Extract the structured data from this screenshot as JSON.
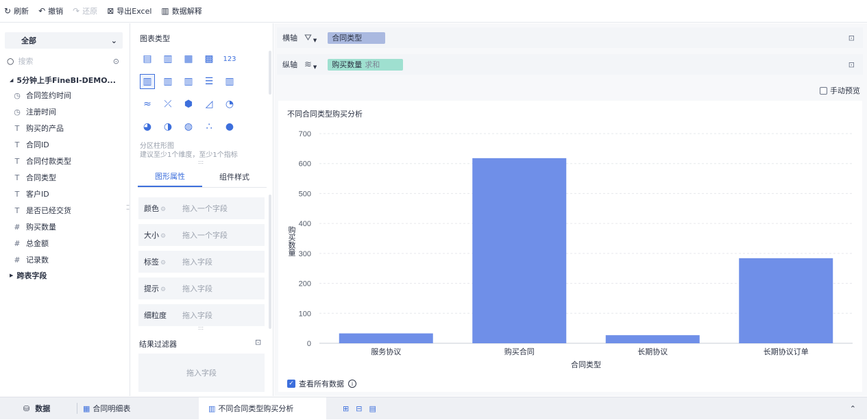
{
  "toolbar": {
    "refresh": "刷新",
    "undo": "撤销",
    "redo": "还原",
    "export": "导出Excel",
    "explain": "数据解释"
  },
  "left": {
    "scope": "全部",
    "search_placeholder": "搜索",
    "root": "5分钟上手FineBI-DEMO...",
    "fields": [
      {
        "icon": "clock-icon",
        "label": "合同签约时间"
      },
      {
        "icon": "clock-icon",
        "label": "注册时间"
      },
      {
        "icon": "text-icon",
        "label": "购买的产品"
      },
      {
        "icon": "text-icon",
        "label": "合同ID"
      },
      {
        "icon": "text-icon",
        "label": "合同付款类型"
      },
      {
        "icon": "text-icon",
        "label": "合同类型"
      },
      {
        "icon": "text-icon",
        "label": "客户ID"
      },
      {
        "icon": "text-icon",
        "label": "是否已经交货"
      },
      {
        "icon": "number-icon",
        "label": "购买数量"
      },
      {
        "icon": "number-icon",
        "label": "总金额"
      },
      {
        "icon": "number-icon",
        "label": "记录数"
      }
    ],
    "cross_table": "跨表字段"
  },
  "middle": {
    "chart_type_title": "图表类型",
    "chart_hint_title": "分区柱形图",
    "chart_hint_desc": "建议至少1个维度，至少1个指标",
    "tab_graph": "图形属性",
    "tab_component": "组件样式",
    "props": [
      {
        "label": "颜色",
        "value": "拖入一个字段",
        "gear": true
      },
      {
        "label": "大小",
        "value": "拖入一个字段",
        "gear": true
      },
      {
        "label": "标签",
        "value": "拖入字段",
        "gear": true
      },
      {
        "label": "提示",
        "value": "拖入字段",
        "gear": true
      },
      {
        "label": "细粒度",
        "value": "拖入字段",
        "gear": false
      }
    ],
    "filter_title": "结果过滤器",
    "filter_placeholder": "拖入字段"
  },
  "right": {
    "x_axis_label": "横轴",
    "x_field": "合同类型",
    "y_axis_label": "纵轴",
    "y_field": "购买数量",
    "y_agg": "求和",
    "manual_preview": "手动预览",
    "view_all": "查看所有数据"
  },
  "chart_data": {
    "type": "bar",
    "title": "不同合同类型购买分析",
    "xlabel": "合同类型",
    "ylabel": "购买数量",
    "categories": [
      "服务协议",
      "购买合同",
      "长期协议",
      "长期协议订单"
    ],
    "values": [
      33,
      618,
      27,
      284
    ],
    "ylim": [
      0,
      700
    ],
    "yticks": [
      0,
      100,
      200,
      300,
      400,
      500,
      600,
      700
    ],
    "color": "#6f8fe8",
    "grid": true
  },
  "bottom": {
    "data_tab": "数据",
    "detail_tab": "合同明细表",
    "analysis_tab": "不同合同类型购买分析"
  },
  "colors": {
    "accent": "#3d6fdc",
    "bar": "#6f8fe8"
  }
}
